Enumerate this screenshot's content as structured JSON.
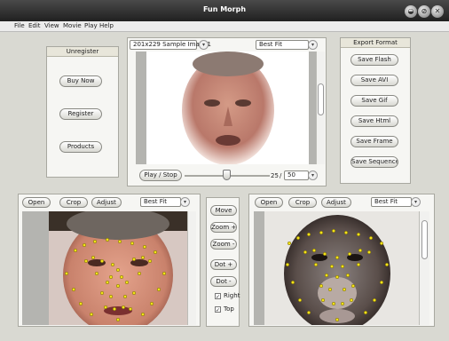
{
  "window": {
    "title": "Fun Morph"
  },
  "menu": [
    "File",
    "Edit",
    "View",
    "Movie",
    "Play",
    "Help"
  ],
  "register_panel": {
    "title": "Unregister",
    "buttons": [
      "Buy Now",
      "Register",
      "Products"
    ]
  },
  "preview": {
    "image_select": "201x229 Sample Image1",
    "fit_select": "Best Fit",
    "play_stop_label": "Play / Stop",
    "frame_current": "25",
    "frame_separator": "/",
    "frame_total": "50",
    "slider_fraction": 0.5
  },
  "export_panel": {
    "title": "Export Format",
    "buttons": [
      "Save Flash",
      "Save AVI",
      "Save Gif",
      "Save Html",
      "Save Frame",
      "Save Sequence"
    ]
  },
  "left_editor": {
    "open_label": "Open",
    "crop_label": "Crop",
    "adjust_label": "Adjust",
    "fit_select": "Best Fit"
  },
  "right_editor": {
    "open_label": "Open",
    "crop_label": "Crop",
    "adjust_label": "Adjust",
    "fit_select": "Best Fit"
  },
  "center_tools": {
    "move_label": "Move",
    "zoom_in_label": "Zoom +",
    "zoom_out_label": "Zoom -",
    "dot_add_label": "Dot +",
    "dot_remove_label": "Dot -",
    "right_label": "Right",
    "top_label": "Top",
    "right_checked": true,
    "top_checked": true
  },
  "colors": {
    "titlebar": "#2b2b2b",
    "dot": "#f2e21a",
    "panel": "#f6f6f3"
  },
  "icons": [
    "minimize-icon",
    "close-icon",
    "chevron-down-icon",
    "slider-thumb-icon",
    "checkbox-checked-icon"
  ]
}
